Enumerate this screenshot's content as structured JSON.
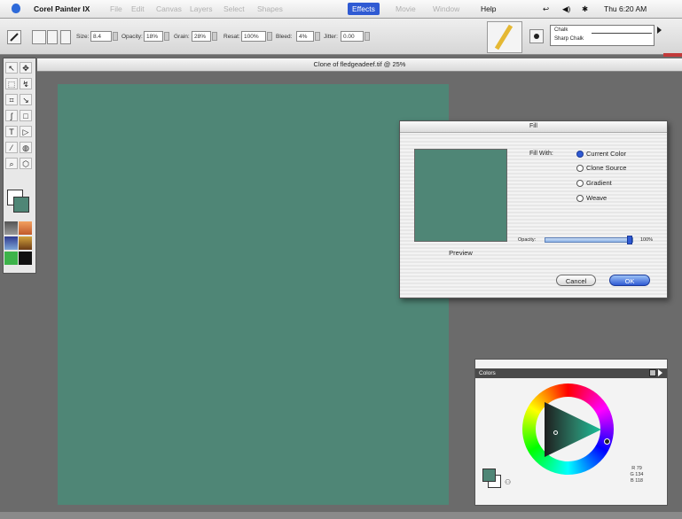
{
  "menubar": {
    "app_name": "Corel Painter IX",
    "items": [
      {
        "label": "File"
      },
      {
        "label": "Edit"
      },
      {
        "label": "Canvas"
      },
      {
        "label": "Layers"
      },
      {
        "label": "Select"
      },
      {
        "label": "Shapes"
      },
      {
        "label": "Effects",
        "active": true
      },
      {
        "label": "Movie"
      },
      {
        "label": "Window"
      },
      {
        "label": "Help"
      }
    ],
    "clock": "Thu 6:20 AM",
    "highlight_color": "#2f5ad3"
  },
  "property_bar": {
    "size_label": "Size:",
    "size_value": "8.4",
    "opacity_label": "Opacity:",
    "opacity_value": "18%",
    "grain_label": "Grain:",
    "grain_value": "28%",
    "resat_label": "Resat:",
    "resat_value": "100%",
    "bleed_label": "Bleed:",
    "bleed_value": "4%",
    "jitter_label": "Jitter:",
    "jitter_value": "0.00",
    "brush_category": "Chalk",
    "brush_variant": "Sharp Chalk"
  },
  "document": {
    "title": "Clone of fledgeadeef.tif @ 25%",
    "canvas_color": "#4f8676"
  },
  "fill_dialog": {
    "title": "Fill",
    "preview_label": "Preview",
    "fill_with_label": "Fill With:",
    "options": [
      {
        "label": "Current Color",
        "selected": true
      },
      {
        "label": "Clone Source",
        "selected": false
      },
      {
        "label": "Gradient",
        "selected": false
      },
      {
        "label": "Weave",
        "selected": false
      }
    ],
    "opacity_label": "Opacity:",
    "opacity_value": "100%",
    "opacity_fraction": 0.93,
    "cancel_label": "Cancel",
    "ok_label": "OK"
  },
  "colors_panel": {
    "title": "Colors",
    "readout": "R 79\nG 134\nB 118"
  },
  "toolbox": {
    "tool_glyphs": [
      "↖",
      "✥",
      "⬚",
      "↯",
      "⌗",
      "↘",
      "ʃ",
      "□",
      "T",
      "▷",
      "⁄",
      "◍",
      "⌕",
      "⬡"
    ]
  }
}
